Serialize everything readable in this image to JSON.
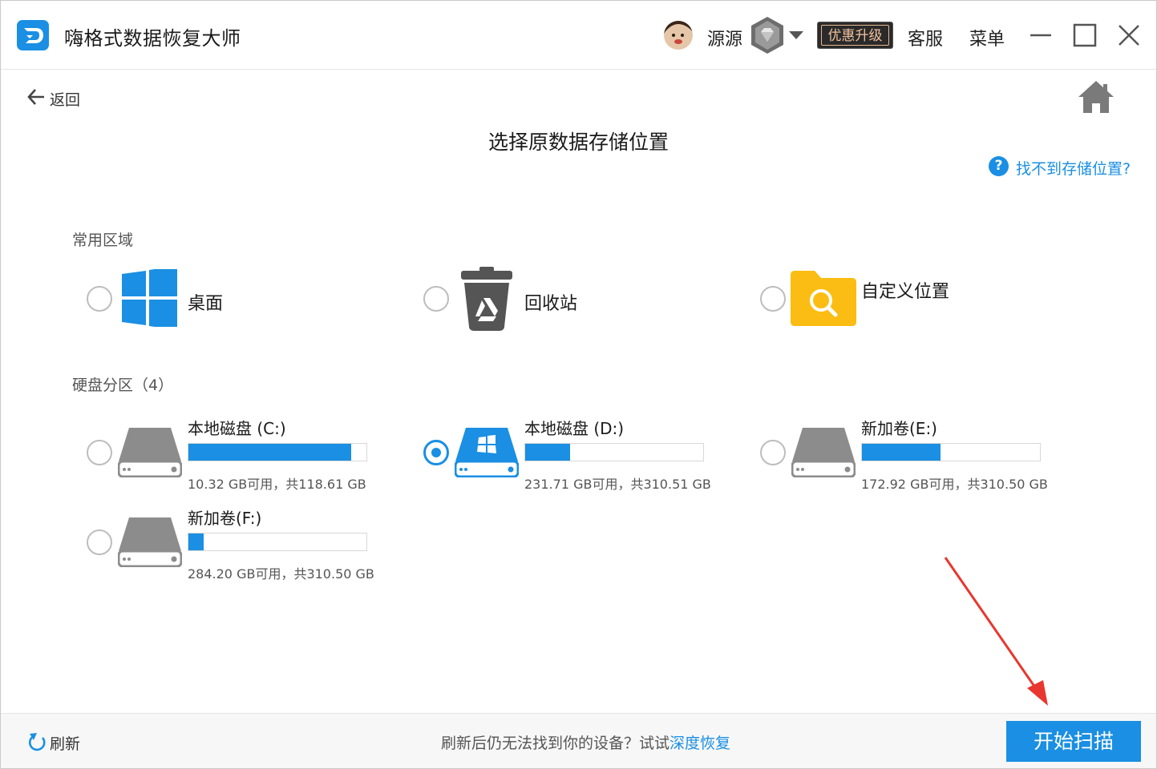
{
  "app": {
    "title": "嗨格式数据恢复大师",
    "username": "源源",
    "upgrade_label": "优惠升级",
    "service_label": "客服",
    "menu_label": "菜单"
  },
  "nav": {
    "back_label": "返回",
    "page_title": "选择原数据存储位置",
    "help_label": "找不到存储位置?",
    "help_icon": "?"
  },
  "common": {
    "section_label": "常用区域",
    "items": [
      {
        "label": "桌面",
        "icon": "windows-icon"
      },
      {
        "label": "回收站",
        "icon": "recycle-bin-icon"
      },
      {
        "label": "自定义位置",
        "icon": "folder-search-icon"
      }
    ]
  },
  "drives": {
    "section_label": "硬盘分区（4）",
    "items": [
      {
        "name": "本地磁盘 (C:)",
        "capacity": "10.32 GB可用，共118.61 GB",
        "used_fraction": 0.913,
        "selected": false
      },
      {
        "name": "本地磁盘 (D:)",
        "capacity": "231.71 GB可用，共310.51 GB",
        "used_fraction": 0.254,
        "selected": true
      },
      {
        "name": "新加卷(E:)",
        "capacity": "172.92 GB可用，共310.50 GB",
        "used_fraction": 0.443,
        "selected": false
      },
      {
        "name": "新加卷(F:)",
        "capacity": "284.20 GB可用，共310.50 GB",
        "used_fraction": 0.085,
        "selected": false
      }
    ]
  },
  "footer": {
    "refresh_label": "刷新",
    "hint_prefix": "刷新后仍无法找到你的设备？试试",
    "deep_recovery_label": "深度恢复",
    "scan_label": "开始扫描"
  },
  "colors": {
    "accent": "#1a8fe3",
    "drive_gray": "#8c8c8c",
    "folder_yellow": "#fbbd13",
    "recycle_gray": "#555555"
  }
}
